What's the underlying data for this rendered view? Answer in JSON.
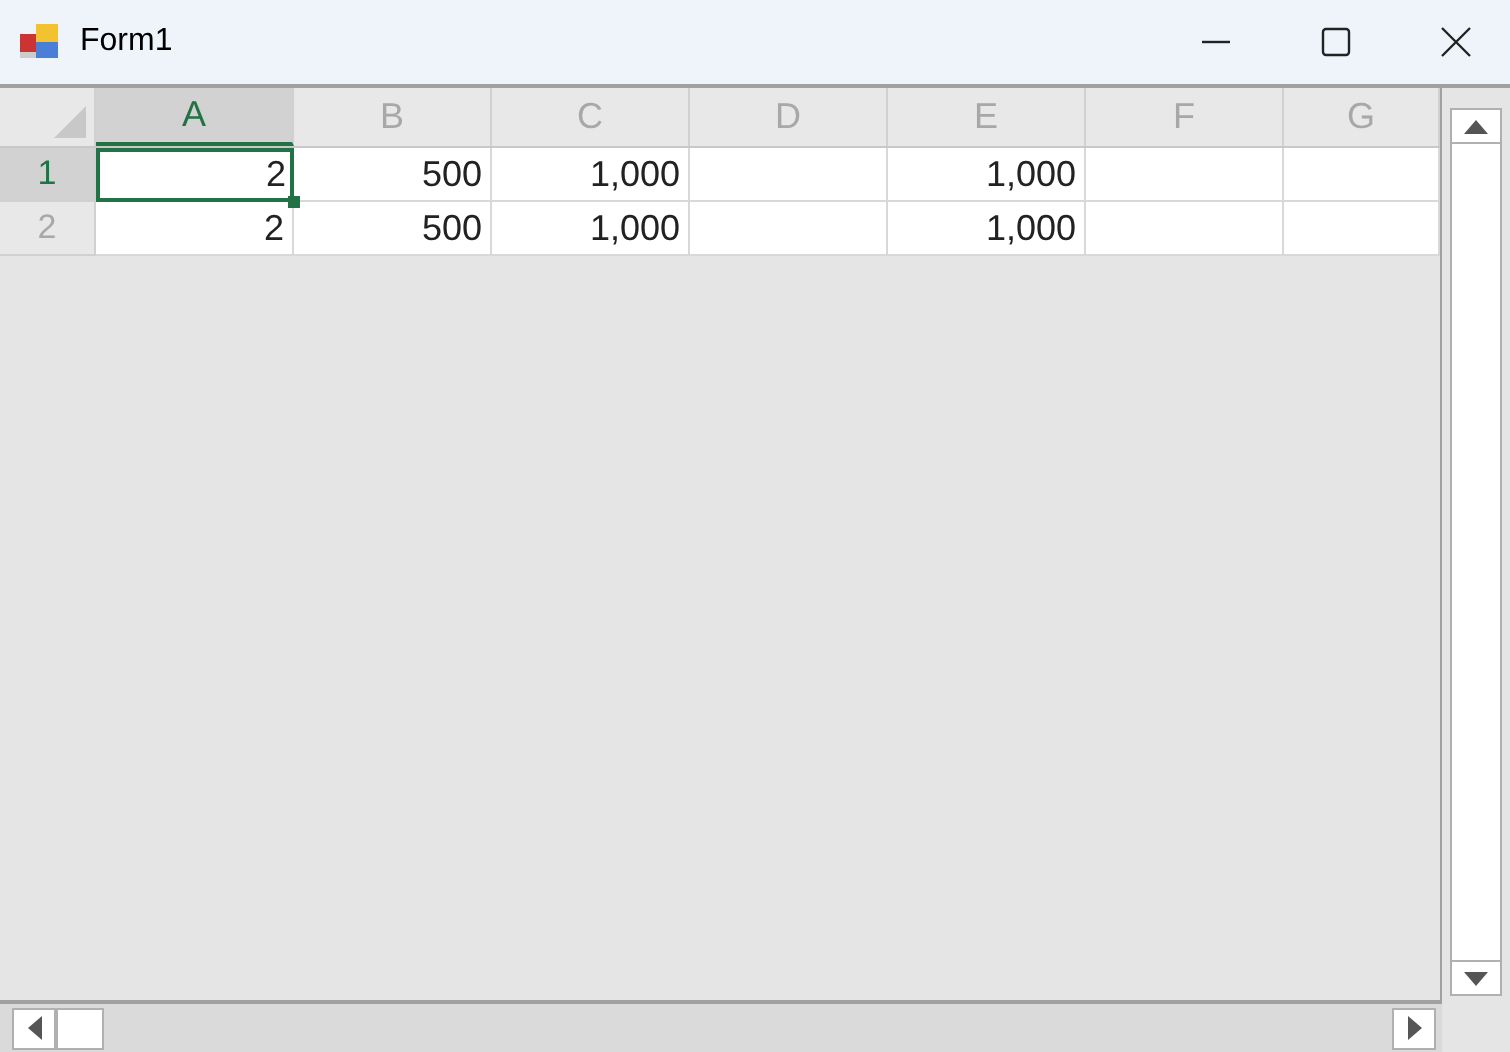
{
  "window": {
    "title": "Form1"
  },
  "columns": [
    {
      "label": "A",
      "selected": true
    },
    {
      "label": "B",
      "selected": false
    },
    {
      "label": "C",
      "selected": false
    },
    {
      "label": "D",
      "selected": false
    },
    {
      "label": "E",
      "selected": false
    },
    {
      "label": "F",
      "selected": false
    },
    {
      "label": "G",
      "selected": false
    }
  ],
  "rows": [
    {
      "label": "1",
      "selected": true,
      "cells": [
        {
          "text": "2",
          "selected": true
        },
        {
          "text": "500",
          "selected": false
        },
        {
          "text": "1,000",
          "selected": false
        },
        {
          "selected": false
        },
        {
          "text": "1,000",
          "selected": false
        },
        {
          "selected": false
        },
        {
          "selected": false
        }
      ]
    },
    {
      "label": "2",
      "selected": false,
      "cells": [
        {
          "text": "2",
          "selected": false
        },
        {
          "text": "500",
          "selected": false
        },
        {
          "text": "1,000",
          "selected": false
        },
        {
          "selected": false
        },
        {
          "text": "1,000",
          "selected": false
        },
        {
          "selected": false
        },
        {
          "selected": false
        }
      ]
    }
  ]
}
